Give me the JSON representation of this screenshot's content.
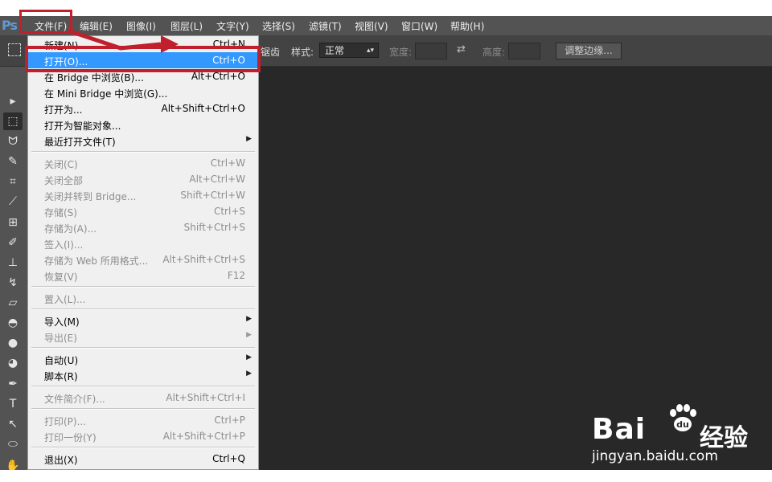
{
  "app": {
    "logo": "Ps"
  },
  "menubar": [
    {
      "label": "文件(F)",
      "name": "menu-file"
    },
    {
      "label": "编辑(E)",
      "name": "menu-edit"
    },
    {
      "label": "图像(I)",
      "name": "menu-image"
    },
    {
      "label": "图层(L)",
      "name": "menu-layer"
    },
    {
      "label": "文字(Y)",
      "name": "menu-type"
    },
    {
      "label": "选择(S)",
      "name": "menu-select"
    },
    {
      "label": "滤镜(T)",
      "name": "menu-filter"
    },
    {
      "label": "视图(V)",
      "name": "menu-view"
    },
    {
      "label": "窗口(W)",
      "name": "menu-window"
    },
    {
      "label": "帮助(H)",
      "name": "menu-help"
    }
  ],
  "options": {
    "antialias_label": "锯齿",
    "style_label": "样式:",
    "style_value": "正常",
    "width_label": "宽度:",
    "height_label": "高度:",
    "refine_button": "调整边缘..."
  },
  "file_menu": {
    "items": [
      {
        "type": "item",
        "label": "新建(N)...",
        "shortcut": "Ctrl+N",
        "enabled": true
      },
      {
        "type": "item",
        "label": "打开(O)...",
        "shortcut": "Ctrl+O",
        "enabled": true,
        "highlighted": true
      },
      {
        "type": "item",
        "label": "在 Bridge 中浏览(B)...",
        "shortcut": "Alt+Ctrl+O",
        "enabled": true
      },
      {
        "type": "item",
        "label": "在 Mini Bridge 中浏览(G)...",
        "shortcut": "",
        "enabled": true
      },
      {
        "type": "item",
        "label": "打开为...",
        "shortcut": "Alt+Shift+Ctrl+O",
        "enabled": true
      },
      {
        "type": "item",
        "label": "打开为智能对象...",
        "shortcut": "",
        "enabled": true
      },
      {
        "type": "item",
        "label": "最近打开文件(T)",
        "shortcut": "",
        "enabled": true,
        "submenu": true
      },
      {
        "type": "sep"
      },
      {
        "type": "item",
        "label": "关闭(C)",
        "shortcut": "Ctrl+W",
        "enabled": false
      },
      {
        "type": "item",
        "label": "关闭全部",
        "shortcut": "Alt+Ctrl+W",
        "enabled": false
      },
      {
        "type": "item",
        "label": "关闭并转到 Bridge...",
        "shortcut": "Shift+Ctrl+W",
        "enabled": false
      },
      {
        "type": "item",
        "label": "存储(S)",
        "shortcut": "Ctrl+S",
        "enabled": false
      },
      {
        "type": "item",
        "label": "存储为(A)...",
        "shortcut": "Shift+Ctrl+S",
        "enabled": false
      },
      {
        "type": "item",
        "label": "签入(I)...",
        "shortcut": "",
        "enabled": false
      },
      {
        "type": "item",
        "label": "存储为 Web 所用格式...",
        "shortcut": "Alt+Shift+Ctrl+S",
        "enabled": false
      },
      {
        "type": "item",
        "label": "恢复(V)",
        "shortcut": "F12",
        "enabled": false
      },
      {
        "type": "sep"
      },
      {
        "type": "item",
        "label": "置入(L)...",
        "shortcut": "",
        "enabled": false
      },
      {
        "type": "sep"
      },
      {
        "type": "item",
        "label": "导入(M)",
        "shortcut": "",
        "enabled": true,
        "submenu": true
      },
      {
        "type": "item",
        "label": "导出(E)",
        "shortcut": "",
        "enabled": false,
        "submenu": true
      },
      {
        "type": "sep"
      },
      {
        "type": "item",
        "label": "自动(U)",
        "shortcut": "",
        "enabled": true,
        "submenu": true
      },
      {
        "type": "item",
        "label": "脚本(R)",
        "shortcut": "",
        "enabled": true,
        "submenu": true
      },
      {
        "type": "sep"
      },
      {
        "type": "item",
        "label": "文件简介(F)...",
        "shortcut": "Alt+Shift+Ctrl+I",
        "enabled": false
      },
      {
        "type": "sep"
      },
      {
        "type": "item",
        "label": "打印(P)...",
        "shortcut": "Ctrl+P",
        "enabled": false
      },
      {
        "type": "item",
        "label": "打印一份(Y)",
        "shortcut": "Alt+Shift+Ctrl+P",
        "enabled": false
      },
      {
        "type": "sep"
      },
      {
        "type": "item",
        "label": "退出(X)",
        "shortcut": "Ctrl+Q",
        "enabled": true
      }
    ]
  },
  "tools": [
    {
      "name": "move-tool-icon",
      "glyph": "▸"
    },
    {
      "name": "rect-marquee-tool-icon",
      "glyph": "⬚",
      "active": true
    },
    {
      "name": "lasso-tool-icon",
      "glyph": "ᗢ"
    },
    {
      "name": "quick-select-tool-icon",
      "glyph": "✎"
    },
    {
      "name": "crop-tool-icon",
      "glyph": "⌗"
    },
    {
      "name": "eyedropper-tool-icon",
      "glyph": "⟋"
    },
    {
      "name": "healing-brush-tool-icon",
      "glyph": "⊞"
    },
    {
      "name": "brush-tool-icon",
      "glyph": "✐"
    },
    {
      "name": "clone-stamp-tool-icon",
      "glyph": "⊥"
    },
    {
      "name": "history-brush-tool-icon",
      "glyph": "↯"
    },
    {
      "name": "eraser-tool-icon",
      "glyph": "▱"
    },
    {
      "name": "paint-bucket-tool-icon",
      "glyph": "◓"
    },
    {
      "name": "blur-tool-icon",
      "glyph": "●"
    },
    {
      "name": "dodge-tool-icon",
      "glyph": "◕"
    },
    {
      "name": "pen-tool-icon",
      "glyph": "✒"
    },
    {
      "name": "type-tool-icon",
      "glyph": "T"
    },
    {
      "name": "path-select-tool-icon",
      "glyph": "↖"
    },
    {
      "name": "shape-tool-icon",
      "glyph": "⬭"
    },
    {
      "name": "hand-tool-icon",
      "glyph": "✋"
    }
  ],
  "watermark": {
    "brand": "Bai du 经验",
    "cn": "经验",
    "url": "jingyan.baidu.com"
  },
  "colors": {
    "highlight": "#3399ff",
    "annotation": "#c0202b",
    "menubar": "#535353",
    "canvas": "#282828"
  }
}
